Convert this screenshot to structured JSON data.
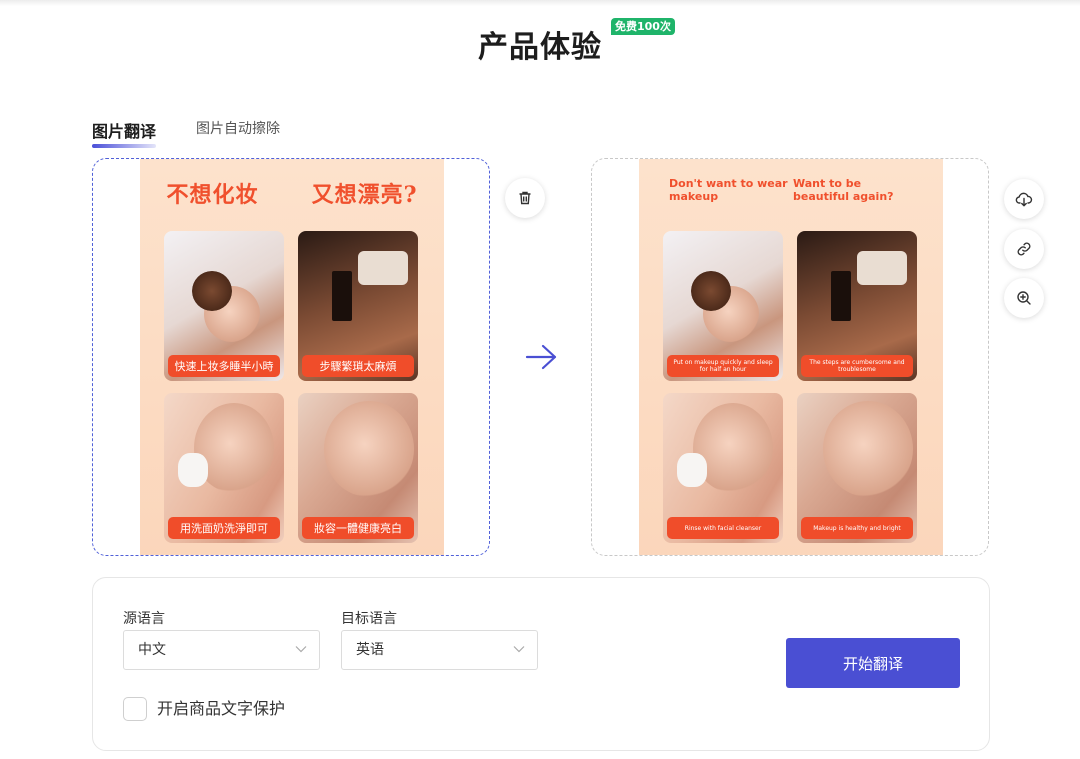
{
  "header": {
    "title": "产品体验",
    "badge": "免费100次"
  },
  "tabs": [
    {
      "label": "图片翻译",
      "active": true
    },
    {
      "label": "图片自动擦除",
      "active": false
    }
  ],
  "source_image": {
    "headline_left": "不想化妆",
    "headline_right": "又想漂亮?",
    "captions": [
      "快速上妆多睡半小時",
      "步驟繁瑣太麻煩",
      "用洗面奶洗淨即可",
      "妝容一體健康亮白"
    ]
  },
  "translated_image": {
    "headline_left": "Don't want to wear makeup",
    "headline_right": "Want to be beautiful again?",
    "captions": [
      "Put on makeup quickly and sleep for half an hour",
      "The steps are cumbersome and troublesome",
      "Rinse with facial cleanser",
      "Makeup is healthy and bright"
    ]
  },
  "actions": {
    "delete_icon": "trash-icon",
    "download_icon": "cloud-download-icon",
    "link_icon": "link-icon",
    "zoom_icon": "zoom-in-icon"
  },
  "settings": {
    "source_label": "源语言",
    "source_value": "中文",
    "target_label": "目标语言",
    "target_value": "英语",
    "protect_label": "开启商品文字保护",
    "protect_checked": false,
    "start_button": "开始翻译"
  },
  "colors": {
    "accent": "#4a4fd3",
    "badge": "#1fb46a",
    "caption": "#f04d2a"
  }
}
